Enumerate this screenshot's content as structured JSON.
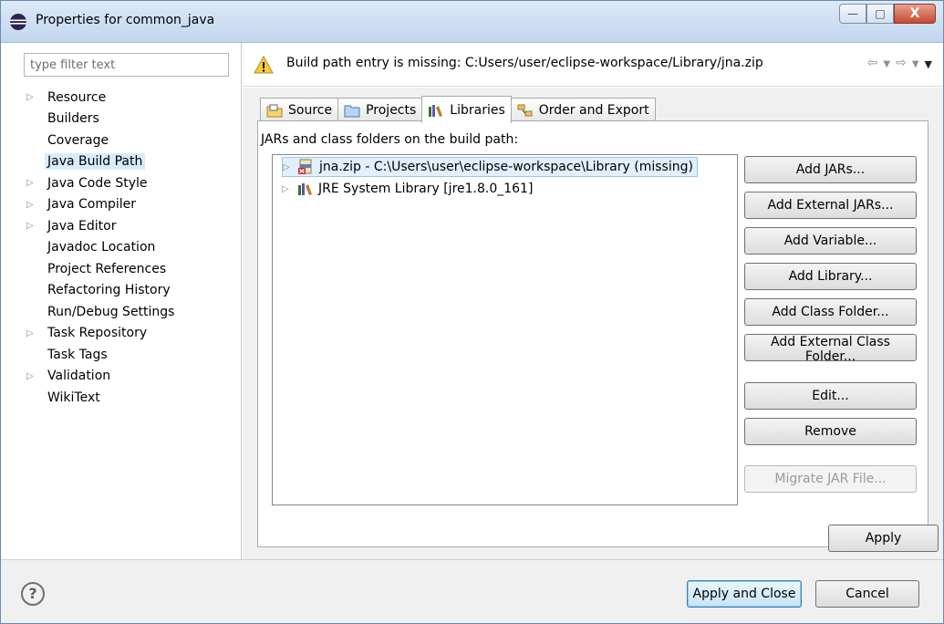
{
  "window": {
    "title": "Properties for common_java",
    "icon": "eclipse-icon",
    "controls": {
      "minimize": "—",
      "maximize": "□",
      "close": "X"
    }
  },
  "sidebar": {
    "filter_placeholder": "type filter text",
    "items": [
      {
        "label": "Resource",
        "expandable": true,
        "selected": false
      },
      {
        "label": "Builders",
        "expandable": false,
        "selected": false
      },
      {
        "label": "Coverage",
        "expandable": false,
        "selected": false
      },
      {
        "label": "Java Build Path",
        "expandable": false,
        "selected": true
      },
      {
        "label": "Java Code Style",
        "expandable": true,
        "selected": false
      },
      {
        "label": "Java Compiler",
        "expandable": true,
        "selected": false
      },
      {
        "label": "Java Editor",
        "expandable": true,
        "selected": false
      },
      {
        "label": "Javadoc Location",
        "expandable": false,
        "selected": false
      },
      {
        "label": "Project References",
        "expandable": false,
        "selected": false
      },
      {
        "label": "Refactoring History",
        "expandable": false,
        "selected": false
      },
      {
        "label": "Run/Debug Settings",
        "expandable": false,
        "selected": false
      },
      {
        "label": "Task Repository",
        "expandable": true,
        "selected": false
      },
      {
        "label": "Task Tags",
        "expandable": false,
        "selected": false
      },
      {
        "label": "Validation",
        "expandable": true,
        "selected": false
      },
      {
        "label": "WikiText",
        "expandable": false,
        "selected": false
      }
    ]
  },
  "header": {
    "message": "Build path entry is missing: C:Users/user/eclipse-workspace/Library/jna.zip",
    "icon": "warning-icon"
  },
  "tabs": [
    {
      "label": "Source",
      "icon": "source-folder-icon",
      "active": false
    },
    {
      "label": "Projects",
      "icon": "projects-folder-icon",
      "active": false
    },
    {
      "label": "Libraries",
      "icon": "libraries-icon",
      "active": true
    },
    {
      "label": "Order and Export",
      "icon": "order-export-icon",
      "active": false
    }
  ],
  "libraries": {
    "label": "JARs and class folders on the build path:",
    "entries": [
      {
        "label": "jna.zip - C:\\Users\\user\\eclipse-workspace\\Library (missing)",
        "icon": "missing-jar-icon",
        "selected": true
      },
      {
        "label": "JRE System Library [jre1.8.0_161]",
        "icon": "library-icon",
        "selected": false
      }
    ],
    "buttons": {
      "add_jars": "Add JARs...",
      "add_external_jars": "Add External JARs...",
      "add_variable": "Add Variable...",
      "add_library": "Add Library...",
      "add_class_folder": "Add Class Folder...",
      "add_external_class_folder": "Add External Class Folder...",
      "edit": "Edit...",
      "remove": "Remove",
      "migrate_jar": "Migrate JAR File..."
    }
  },
  "footer": {
    "apply": "Apply",
    "apply_and_close": "Apply and Close",
    "cancel": "Cancel",
    "help": "?"
  }
}
